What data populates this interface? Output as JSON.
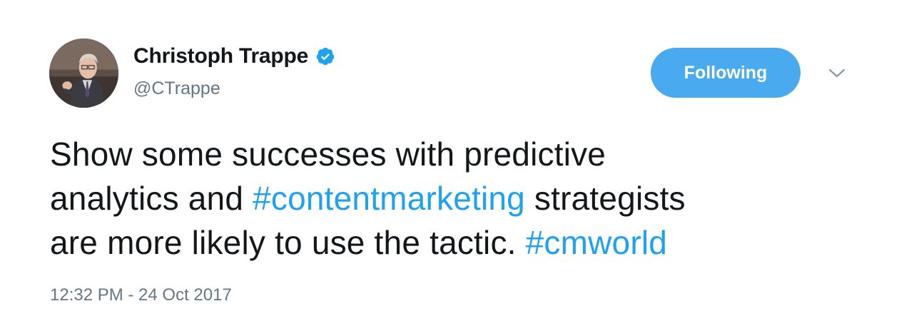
{
  "author": {
    "display_name": "Christoph Trappe",
    "handle": "@CTrappe",
    "verified": true
  },
  "follow_button": {
    "label": "Following"
  },
  "tweet": {
    "line1": "Show some successes with predictive",
    "line2_prefix": "analytics and ",
    "hashtag1": "#contentmarketing",
    "line2_suffix": " strategists",
    "line3_prefix": "are more likely to use the tactic. ",
    "hashtag2": "#cmworld"
  },
  "timestamp": "12:32 PM - 24 Oct 2017",
  "icons": {
    "verified": "verified-badge-icon",
    "menu": "chevron-down-icon"
  },
  "colors": {
    "follow_button_bg": "#4aaaf0",
    "hashtag": "#1da1f2",
    "text": "#14171a",
    "secondary_text": "#657786"
  }
}
